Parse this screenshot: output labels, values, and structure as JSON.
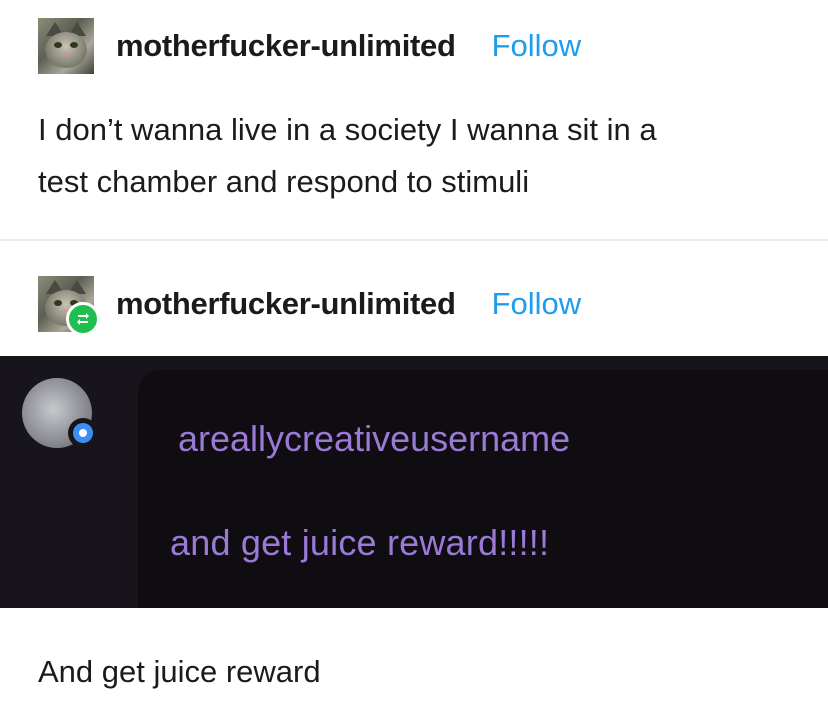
{
  "post1": {
    "username": "motherfucker-unlimited",
    "follow_label": "Follow",
    "text_line1": "I don’t wanna live in a society I wanna sit in a",
    "text_line2": "test chamber and respond to stimuli"
  },
  "post2": {
    "username": "motherfucker-unlimited",
    "follow_label": "Follow",
    "reblog_icon": "reblog-icon",
    "quoted": {
      "username": "areallycreativeusername",
      "message": "and get juice reward!!!!!",
      "text_color": "#9b7ad6",
      "background": "#17141b"
    },
    "caption": "And get juice reward"
  },
  "colors": {
    "follow": "#1e9cf0",
    "reblog_badge": "#1fbf4f",
    "dm_avatar_dot": "#3b8ef3"
  }
}
